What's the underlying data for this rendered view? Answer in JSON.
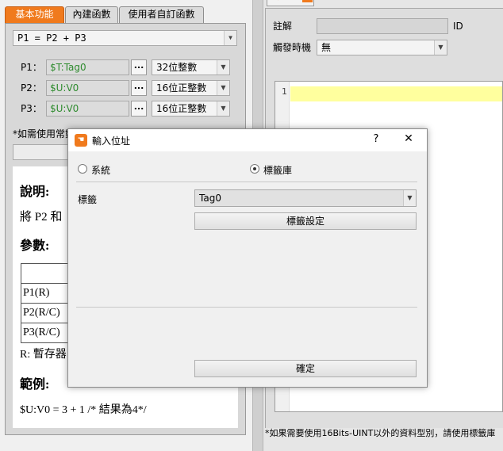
{
  "left": {
    "tabs": [
      "基本功能",
      "內建函數",
      "使用者自訂函數"
    ],
    "formula": "P1 = P2 + P3",
    "params": [
      {
        "label": "P1：",
        "value": "$T:Tag0",
        "more": "...",
        "type": "32位整數"
      },
      {
        "label": "P2：",
        "value": "$U:V0",
        "more": "...",
        "type": "16位正整數"
      },
      {
        "label": "P3：",
        "value": "$U:V0",
        "more": "...",
        "type": "16位正整數"
      }
    ],
    "note": "*如需使用常數",
    "doc": {
      "desc_heading": "說明:",
      "desc_text": "將 P2 和",
      "params_heading": "參數:",
      "table_rows": [
        "",
        "P1(R)",
        "P2(R/C)",
        "P3(R/C)"
      ],
      "reg_text": "R: 暫存器",
      "example_heading": "範例:",
      "example_text": "$U:V0 = 3 + 1 /* 結果為4*/"
    }
  },
  "right": {
    "tab_number": "0",
    "comment_label": "註解",
    "id_label": "ID",
    "trigger_label": "觸發時機",
    "trigger_value": "無",
    "line_number": "1",
    "footer_note": "*如果需要使用16Bits-UINT以外的資料型別，請使用標籤庫"
  },
  "dialog": {
    "title": "輸入位址",
    "help": "?",
    "close": "✕",
    "radio_system": "系統",
    "radio_tag": "標籤庫",
    "tag_label": "標籤",
    "tag_value": "Tag0",
    "settings_button": "標籤設定",
    "ok_button": "確定"
  },
  "colors": {
    "accent": "#f07a1d",
    "tag_text": "#2e8b2e",
    "highlight": "#ffff9e"
  }
}
